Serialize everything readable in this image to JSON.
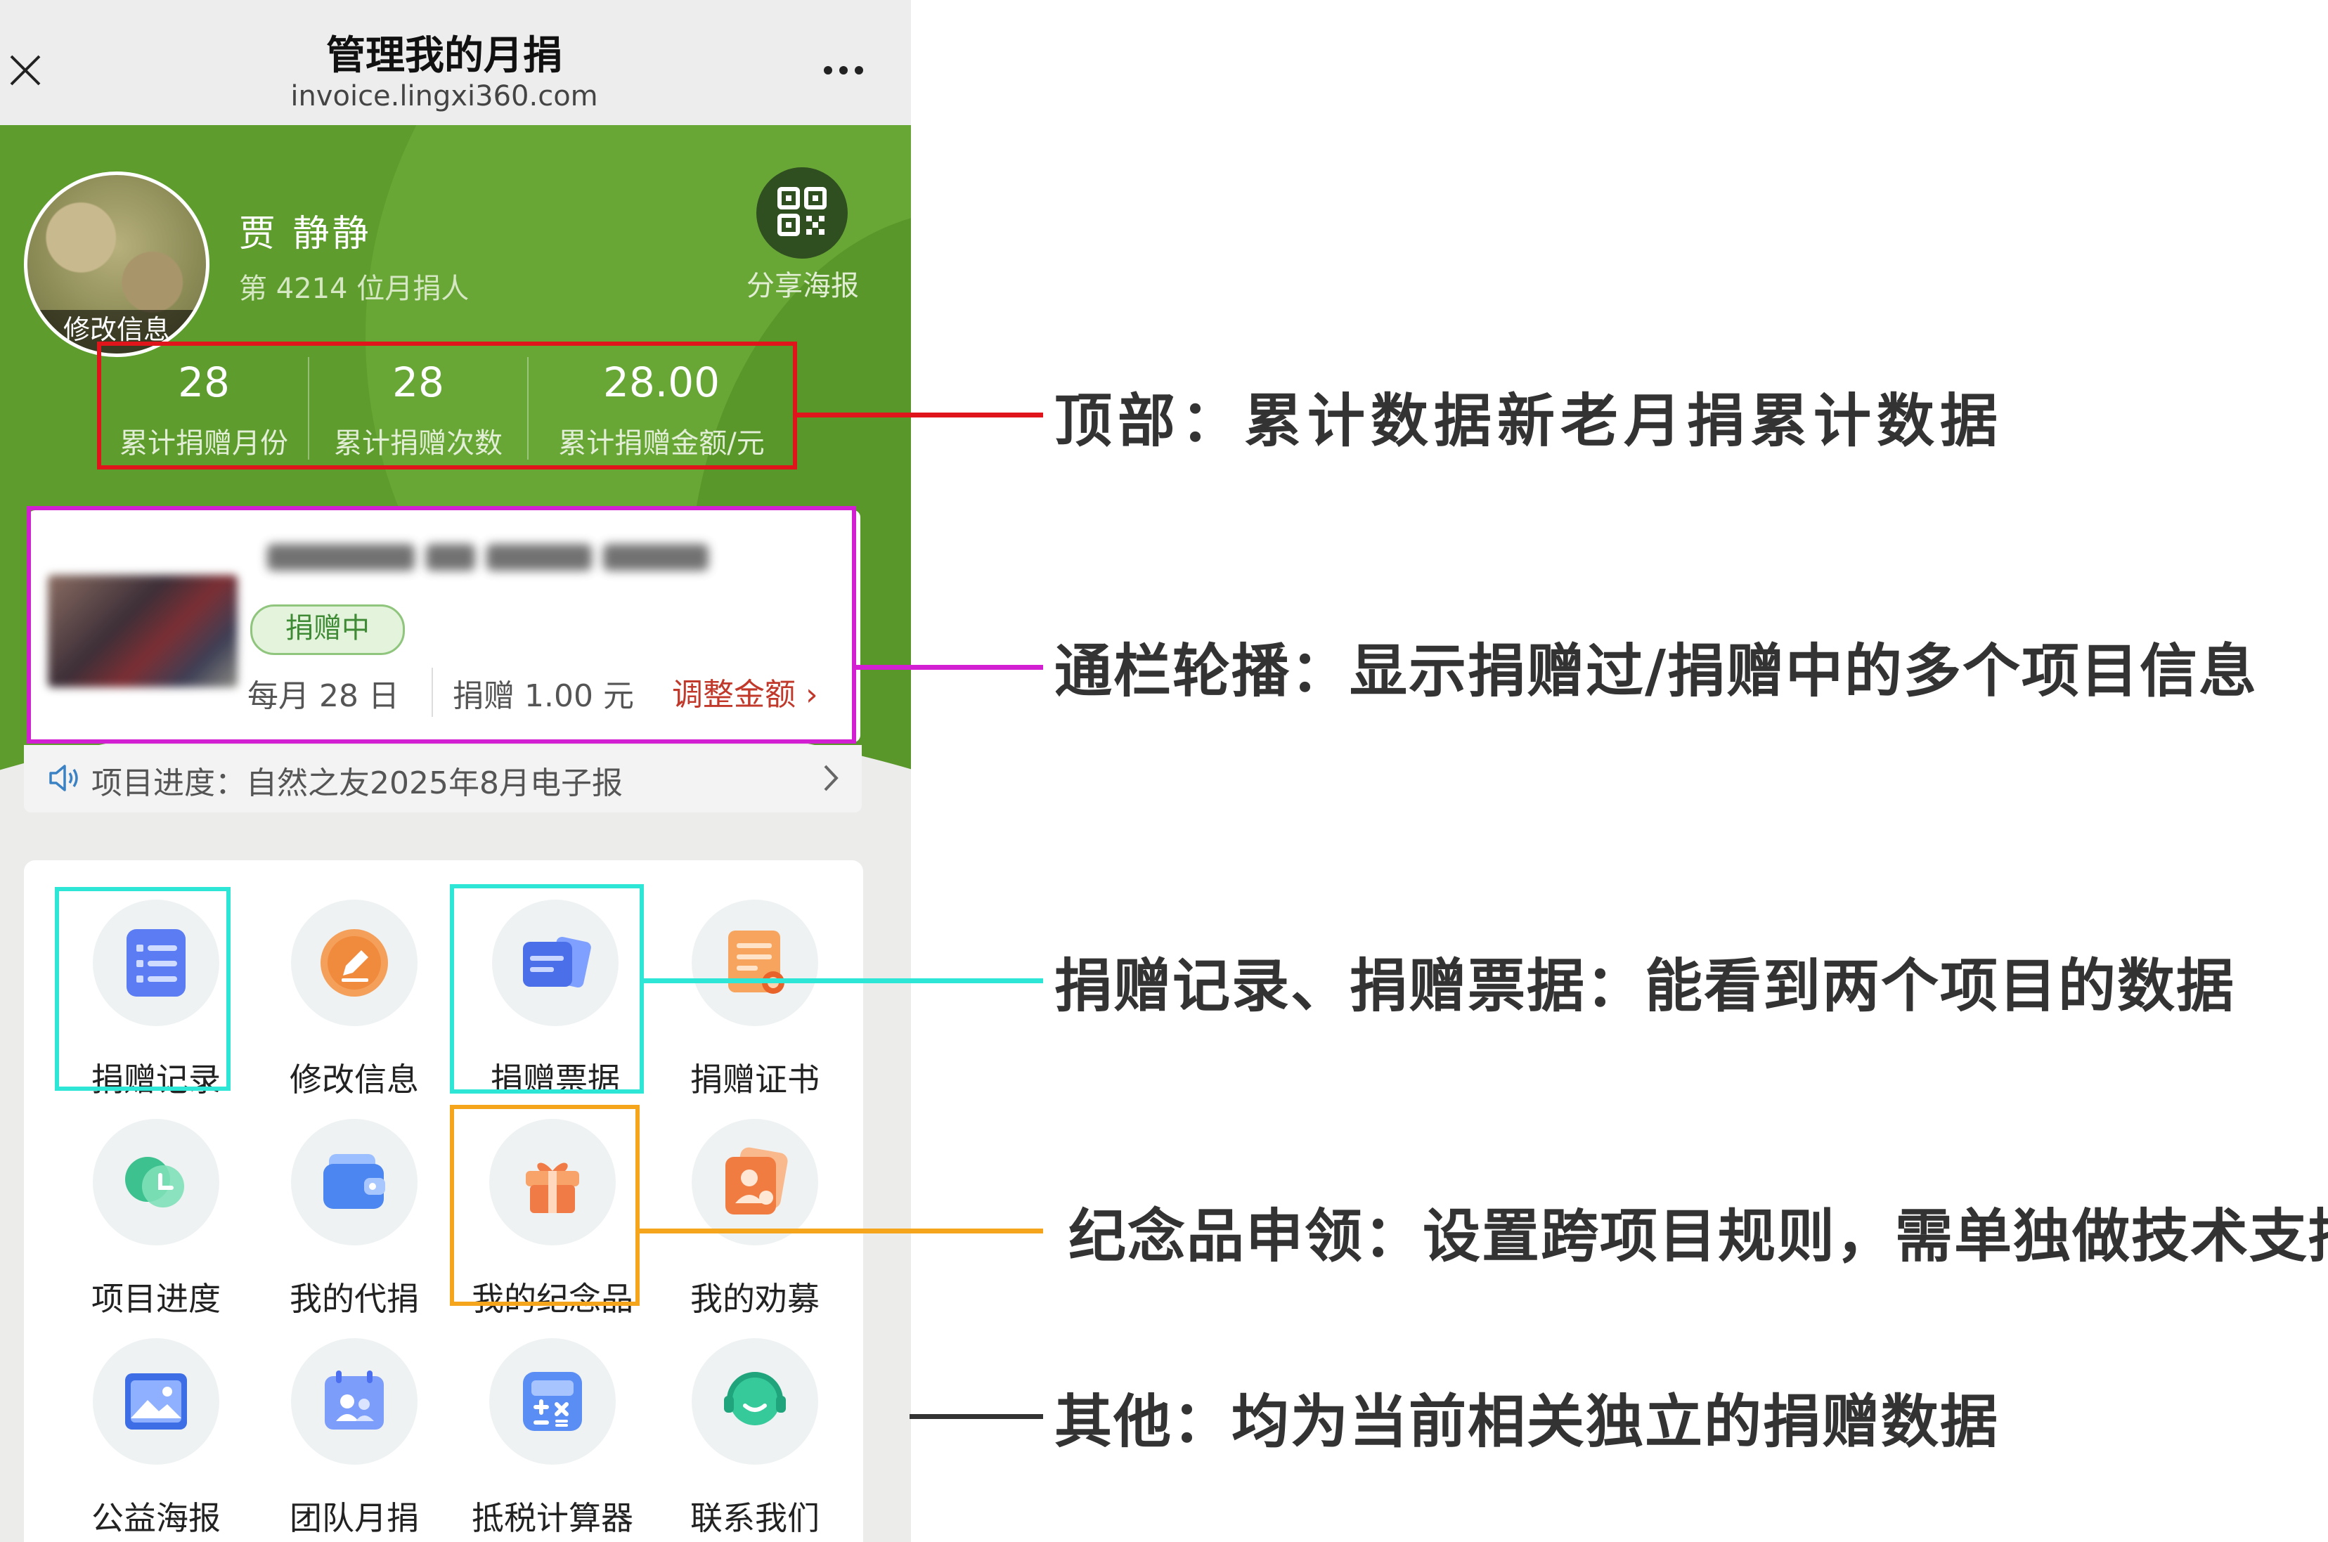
{
  "navbar": {
    "title": "管理我的月捐",
    "url": "invoice.lingxi360.com"
  },
  "profile": {
    "name": "贾 静静",
    "rank": "第 4214 位月捐人",
    "avatar_label": "修改信息",
    "share_label": "分享海报"
  },
  "stats": [
    {
      "value": "28",
      "label": "累计捐赠月份"
    },
    {
      "value": "28",
      "label": "累计捐赠次数"
    },
    {
      "value": "28.00",
      "label": "累计捐赠金额/元"
    }
  ],
  "carousel": {
    "status_badge": "捐赠中",
    "date": "每月 28 日",
    "amount": "捐赠 1.00 元",
    "adjust_label": "调整金额 ›"
  },
  "progress": {
    "label": "项目进度：自然之友2025年8月电子报"
  },
  "grid": [
    {
      "label": "捐赠记录",
      "icon": "donation-record-icon"
    },
    {
      "label": "修改信息",
      "icon": "edit-info-icon"
    },
    {
      "label": "捐赠票据",
      "icon": "donation-receipt-icon"
    },
    {
      "label": "捐赠证书",
      "icon": "donation-certificate-icon"
    },
    {
      "label": "项目进度",
      "icon": "project-progress-icon"
    },
    {
      "label": "我的代捐",
      "icon": "wallet-icon"
    },
    {
      "label": "我的纪念品",
      "icon": "gift-icon"
    },
    {
      "label": "我的劝募",
      "icon": "fundraise-icon"
    },
    {
      "label": "公益海报",
      "icon": "poster-icon"
    },
    {
      "label": "团队月捐",
      "icon": "team-icon"
    },
    {
      "label": "抵税计算器",
      "icon": "calculator-icon"
    },
    {
      "label": "联系我们",
      "icon": "contact-icon"
    }
  ],
  "annotations": {
    "top": "顶部：累计数据新老月捐累计数据",
    "carousel": "通栏轮播：显示捐赠过/捐赠中的多个项目信息",
    "records": "捐赠记录、捐赠票据：能看到两个项目的数据",
    "souvenir": "纪念品申领：设置跨项目规则，需单独做技术支持",
    "other": "其他：均为当前相关独立的捐赠数据"
  },
  "colors": {
    "brand_green": "#5e9c2d",
    "annotation_red": "#e0141b",
    "annotation_magenta": "#d21fd2",
    "annotation_cyan": "#2ee6d6",
    "annotation_orange": "#f4a51c",
    "annotation_gray": "#333333",
    "adjust_red": "#c0392b"
  }
}
